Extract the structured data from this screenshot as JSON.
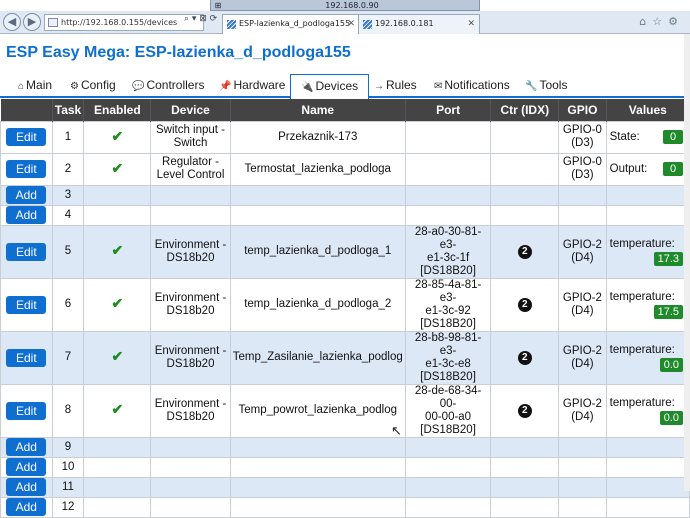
{
  "remote_session": {
    "title": "192.168.0.90"
  },
  "browser": {
    "address": "http://192.168.0.155/devices",
    "tabs": [
      {
        "label": "ESP-lazienka_d_podloga155"
      },
      {
        "label": "192.168.0.181"
      }
    ]
  },
  "page": {
    "title": "ESP Easy Mega: ESP-lazienka_d_podloga155"
  },
  "menu": [
    {
      "icon": "⌂",
      "label": "Main"
    },
    {
      "icon": "⚙",
      "label": "Config"
    },
    {
      "icon": "💬",
      "label": "Controllers"
    },
    {
      "icon": "📌",
      "label": "Hardware"
    },
    {
      "icon": "🔌",
      "label": "Devices"
    },
    {
      "icon": "→",
      "label": "Rules"
    },
    {
      "icon": "✉",
      "label": "Notifications"
    },
    {
      "icon": "🔧",
      "label": "Tools"
    }
  ],
  "table": {
    "headers": [
      "",
      "Task",
      "Enabled",
      "Device",
      "Name",
      "Port",
      "Ctr (IDX)",
      "GPIO",
      "Values"
    ],
    "rows": [
      {
        "button": "Edit",
        "task": "1",
        "enabled": "✔",
        "device_l1": "Switch input -",
        "device_l2": "Switch",
        "name": "Przekaznik-173",
        "port_l1": "",
        "port_l2": "",
        "port_l3": "",
        "ctr": "",
        "gpio_l1": "GPIO-0",
        "gpio_l2": "(D3)",
        "value_name": "State:",
        "value": "0"
      },
      {
        "button": "Edit",
        "task": "2",
        "enabled": "✔",
        "device_l1": "Regulator -",
        "device_l2": "Level Control",
        "name": "Termostat_lazienka_podloga",
        "port_l1": "",
        "port_l2": "",
        "port_l3": "",
        "ctr": "",
        "gpio_l1": "GPIO-0",
        "gpio_l2": "(D3)",
        "value_name": "Output:",
        "value": "0"
      },
      {
        "button": "Add",
        "task": "3"
      },
      {
        "button": "Add",
        "task": "4"
      },
      {
        "button": "Edit",
        "task": "5",
        "enabled": "✔",
        "device_l1": "Environment -",
        "device_l2": "DS18b20",
        "name": "temp_lazienka_d_podloga_1",
        "port_l1": "28-a0-30-81-e3-",
        "port_l2": "e1-3c-1f",
        "port_l3": "[DS18B20]",
        "ctr": "2",
        "gpio_l1": "GPIO-2",
        "gpio_l2": "(D4)",
        "value_name": "temperature:",
        "value": "17.3"
      },
      {
        "button": "Edit",
        "task": "6",
        "enabled": "✔",
        "device_l1": "Environment -",
        "device_l2": "DS18b20",
        "name": "temp_lazienka_d_podloga_2",
        "port_l1": "28-85-4a-81-e3-",
        "port_l2": "e1-3c-92",
        "port_l3": "[DS18B20]",
        "ctr": "2",
        "gpio_l1": "GPIO-2",
        "gpio_l2": "(D4)",
        "value_name": "temperature:",
        "value": "17.5"
      },
      {
        "button": "Edit",
        "task": "7",
        "enabled": "✔",
        "device_l1": "Environment -",
        "device_l2": "DS18b20",
        "name": "Temp_Zasilanie_lazienka_podlog",
        "port_l1": "28-b8-98-81-e3-",
        "port_l2": "e1-3c-e8",
        "port_l3": "[DS18B20]",
        "ctr": "2",
        "gpio_l1": "GPIO-2",
        "gpio_l2": "(D4)",
        "value_name": "temperature:",
        "value": "0.0"
      },
      {
        "button": "Edit",
        "task": "8",
        "enabled": "✔",
        "device_l1": "Environment -",
        "device_l2": "DS18b20",
        "name": "Temp_powrot_lazienka_podlog",
        "port_l1": "28-de-68-34-00-",
        "port_l2": "00-00-a0",
        "port_l3": "[DS18B20]",
        "ctr": "2",
        "gpio_l1": "GPIO-2",
        "gpio_l2": "(D4)",
        "value_name": "temperature:",
        "value": "0.0"
      },
      {
        "button": "Add",
        "task": "9"
      },
      {
        "button": "Add",
        "task": "10"
      },
      {
        "button": "Add",
        "task": "11"
      },
      {
        "button": "Add",
        "task": "12"
      }
    ]
  },
  "colors": {
    "accent": "#0f6fd0",
    "value_badge": "#1f8a2a",
    "header_bg": "#444444",
    "row_alt": "#dde8f7"
  }
}
